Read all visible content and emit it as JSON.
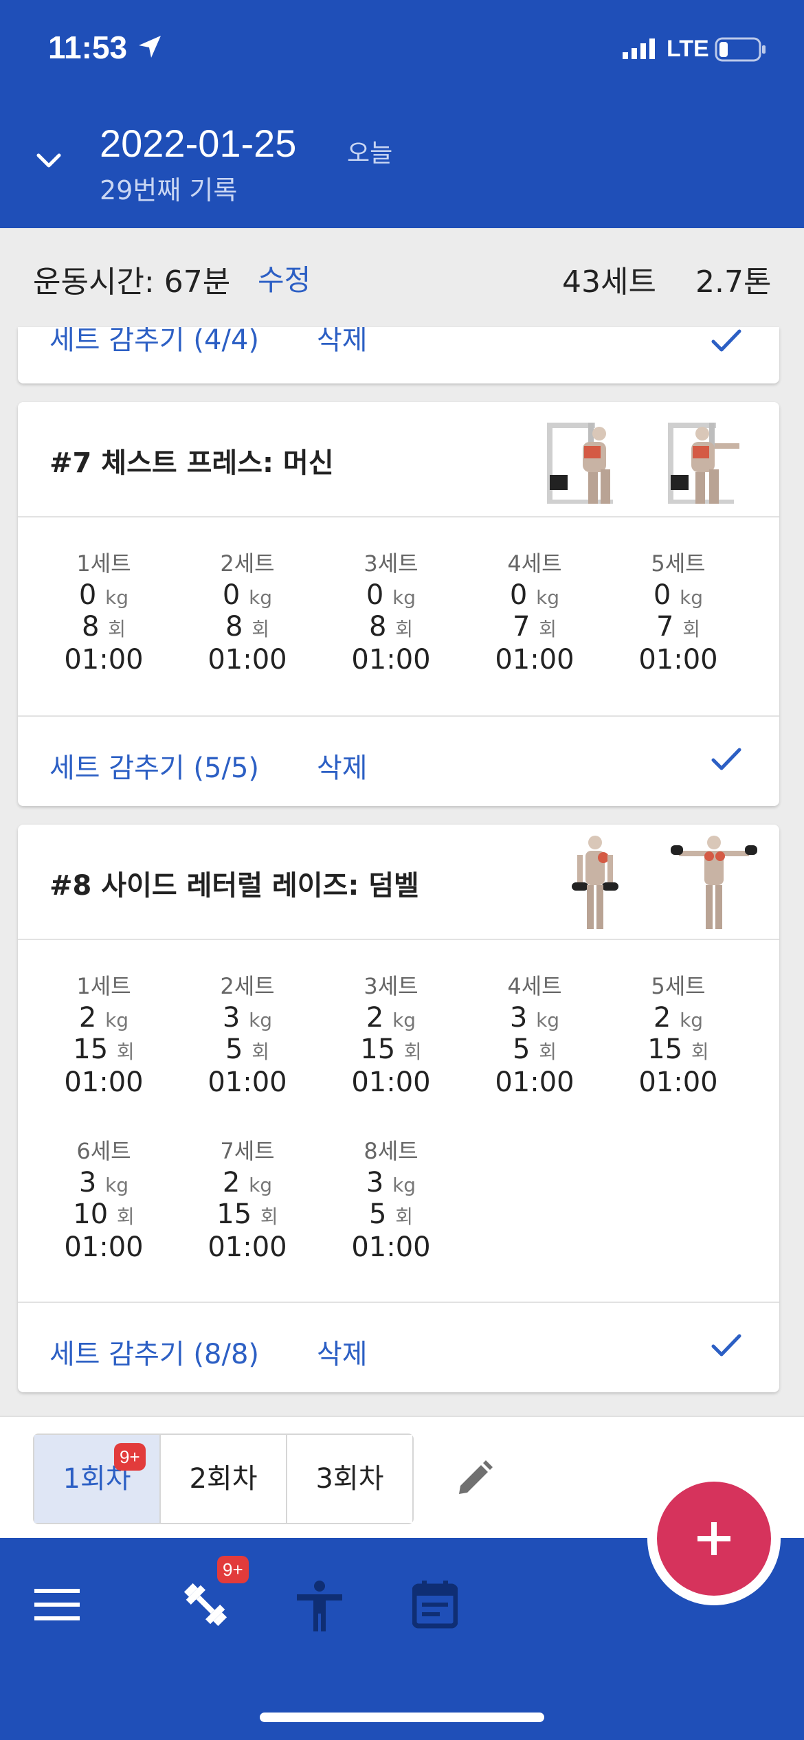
{
  "status": {
    "time": "11:53",
    "network": "LTE"
  },
  "header": {
    "date": "2022-01-25",
    "today": "오늘",
    "record": "29번째 기록"
  },
  "summary": {
    "time_label": "운동시간: 67분",
    "edit": "수정",
    "sets": "43세트",
    "tons": "2.7톤"
  },
  "card6": {
    "hide_sets": "세트 감추기 (4/4)",
    "delete": "삭제"
  },
  "card7": {
    "title": "#7 체스트 프레스: 머신",
    "sets": [
      {
        "label": "1세트",
        "weight": "0",
        "reps": "8",
        "time": "01:00"
      },
      {
        "label": "2세트",
        "weight": "0",
        "reps": "8",
        "time": "01:00"
      },
      {
        "label": "3세트",
        "weight": "0",
        "reps": "8",
        "time": "01:00"
      },
      {
        "label": "4세트",
        "weight": "0",
        "reps": "7",
        "time": "01:00"
      },
      {
        "label": "5세트",
        "weight": "0",
        "reps": "7",
        "time": "01:00"
      }
    ],
    "hide_sets": "세트 감추기 (5/5)",
    "delete": "삭제"
  },
  "card8": {
    "title": "#8 사이드 레터럴 레이즈: 덤벨",
    "sets": [
      {
        "label": "1세트",
        "weight": "2",
        "reps": "15",
        "time": "01:00"
      },
      {
        "label": "2세트",
        "weight": "3",
        "reps": "5",
        "time": "01:00"
      },
      {
        "label": "3세트",
        "weight": "2",
        "reps": "15",
        "time": "01:00"
      },
      {
        "label": "4세트",
        "weight": "3",
        "reps": "5",
        "time": "01:00"
      },
      {
        "label": "5세트",
        "weight": "2",
        "reps": "15",
        "time": "01:00"
      },
      {
        "label": "6세트",
        "weight": "3",
        "reps": "10",
        "time": "01:00"
      },
      {
        "label": "7세트",
        "weight": "2",
        "reps": "15",
        "time": "01:00"
      },
      {
        "label": "8세트",
        "weight": "3",
        "reps": "5",
        "time": "01:00"
      }
    ],
    "hide_sets": "세트 감추기 (8/8)",
    "delete": "삭제"
  },
  "units": {
    "kg": "kg",
    "reps": "회"
  },
  "sessions": {
    "tabs": [
      "1회차",
      "2회차",
      "3회차"
    ],
    "badge": "9+"
  },
  "nav": {
    "badge": "9+",
    "fab": "+"
  },
  "colors": {
    "brand": "#1f4fb8",
    "accent": "#2c5fc4",
    "fab": "#d6335c",
    "badge": "#e23b3b"
  },
  "icons": [
    "location-arrow-icon",
    "signal-icon",
    "battery-icon",
    "chevron-down-icon",
    "check-icon",
    "pencil-icon",
    "menu-icon",
    "dumbbell-icon",
    "person-icon",
    "calendar-icon",
    "plus-icon"
  ]
}
